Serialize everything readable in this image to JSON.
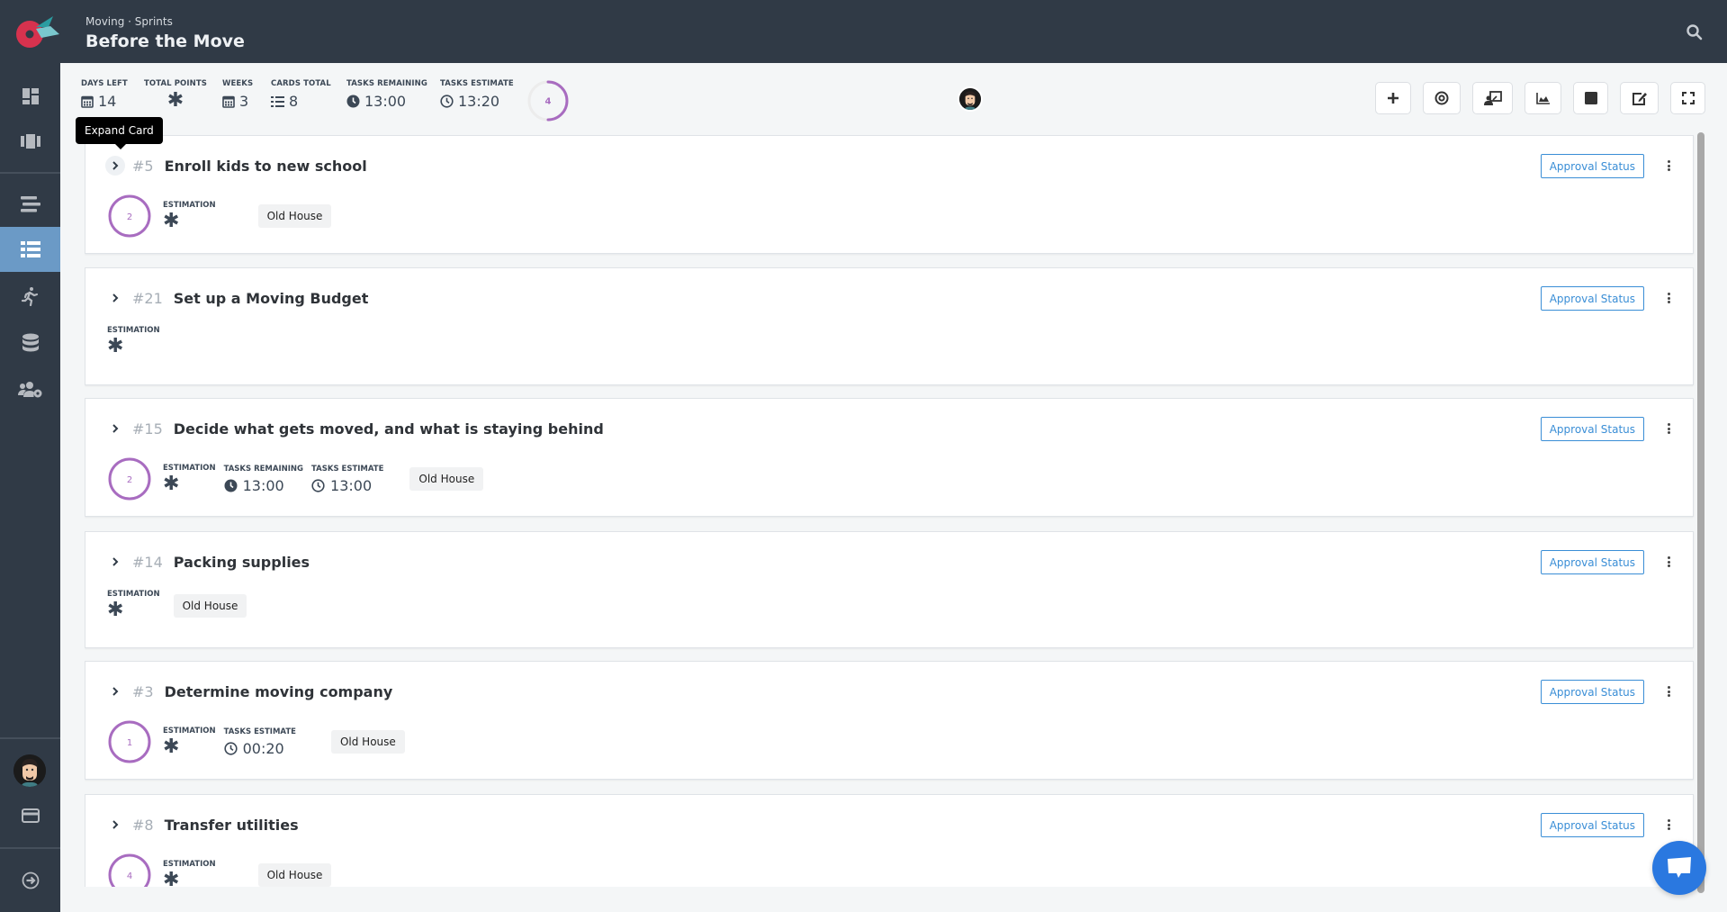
{
  "header": {
    "breadcrumb": "Moving · Sprints",
    "title": "Before the Move",
    "search_icon": "search-icon"
  },
  "sidebar": {
    "items": [
      {
        "name": "dashboard",
        "icon": "dashboard-icon",
        "active": false
      },
      {
        "name": "boards",
        "icon": "board-icon",
        "active": false
      },
      {
        "name": "backlog",
        "icon": "list-lines-icon",
        "active": false
      },
      {
        "name": "sprints",
        "icon": "table-list-icon",
        "active": true
      },
      {
        "name": "activity",
        "icon": "running-icon",
        "active": false
      },
      {
        "name": "database",
        "icon": "database-icon",
        "active": false
      },
      {
        "name": "team-settings",
        "icon": "users-cog-icon",
        "active": false
      }
    ],
    "bottom": [
      {
        "name": "user-avatar",
        "icon": "avatar"
      },
      {
        "name": "billing",
        "icon": "credit-card-icon"
      },
      {
        "name": "logout",
        "icon": "arrow-circle-right-icon"
      }
    ]
  },
  "stats": {
    "days_left": {
      "label": "DAYS LEFT",
      "value": "14"
    },
    "total_points": {
      "label": "TOTAL POINTS",
      "value": "✱"
    },
    "weeks": {
      "label": "WEEKS",
      "value": "3"
    },
    "cards_total": {
      "label": "CARDS TOTAL",
      "value": "8"
    },
    "tasks_remaining": {
      "label": "TASKS REMAINING",
      "value": "13:00"
    },
    "tasks_estimate": {
      "label": "TASKS ESTIMATE",
      "value": "13:20"
    },
    "progress_ring": {
      "value": "4",
      "fraction": 0.5
    }
  },
  "toolbar": {
    "buttons": [
      {
        "name": "add",
        "icon": "plus-icon"
      },
      {
        "name": "goal",
        "icon": "target-icon"
      },
      {
        "name": "presentation",
        "icon": "presenter-icon"
      },
      {
        "name": "chart",
        "icon": "area-chart-icon"
      },
      {
        "name": "stop",
        "icon": "stop-icon"
      },
      {
        "name": "edit",
        "icon": "edit-icon"
      },
      {
        "name": "fullscreen",
        "icon": "expand-icon"
      }
    ]
  },
  "tooltip": "Expand Card",
  "cards": [
    {
      "num": "#5",
      "title": "Enroll kids to new school",
      "ring": "2",
      "estimation_label": "ESTIMATION",
      "estimation": "✱",
      "tag": "Old House",
      "approval": "Approval Status"
    },
    {
      "num": "#21",
      "title": "Set up a Moving Budget",
      "ring": null,
      "estimation_label": "ESTIMATION",
      "estimation": "✱",
      "tag": null,
      "approval": "Approval Status"
    },
    {
      "num": "#15",
      "title": "Decide what gets moved, and what is staying behind",
      "ring": "2",
      "estimation_label": "ESTIMATION",
      "estimation": "✱",
      "tasks_remaining_label": "TASKS REMAINING",
      "tasks_remaining": "13:00",
      "tasks_estimate_label": "TASKS ESTIMATE",
      "tasks_estimate": "13:00",
      "tag": "Old House",
      "approval": "Approval Status"
    },
    {
      "num": "#14",
      "title": "Packing supplies",
      "ring": null,
      "estimation_label": "ESTIMATION",
      "estimation": "✱",
      "tag": "Old House",
      "approval": "Approval Status"
    },
    {
      "num": "#3",
      "title": "Determine moving company",
      "ring": "1",
      "estimation_label": "ESTIMATION",
      "estimation": "✱",
      "tasks_estimate_label": "TASKS ESTIMATE",
      "tasks_estimate": "00:20",
      "tag": "Old House",
      "approval": "Approval Status"
    },
    {
      "num": "#8",
      "title": "Transfer utilities",
      "ring": "4",
      "estimation_label": "ESTIMATION",
      "estimation": "✱",
      "tag": "Old House",
      "approval": "Approval Status"
    }
  ],
  "colors": {
    "topbar": "#303a46",
    "sidebar_active": "#6b9ac6",
    "ring": "#a86cc0",
    "approval": "#3a8ed6",
    "chat": "#2a78e0"
  }
}
